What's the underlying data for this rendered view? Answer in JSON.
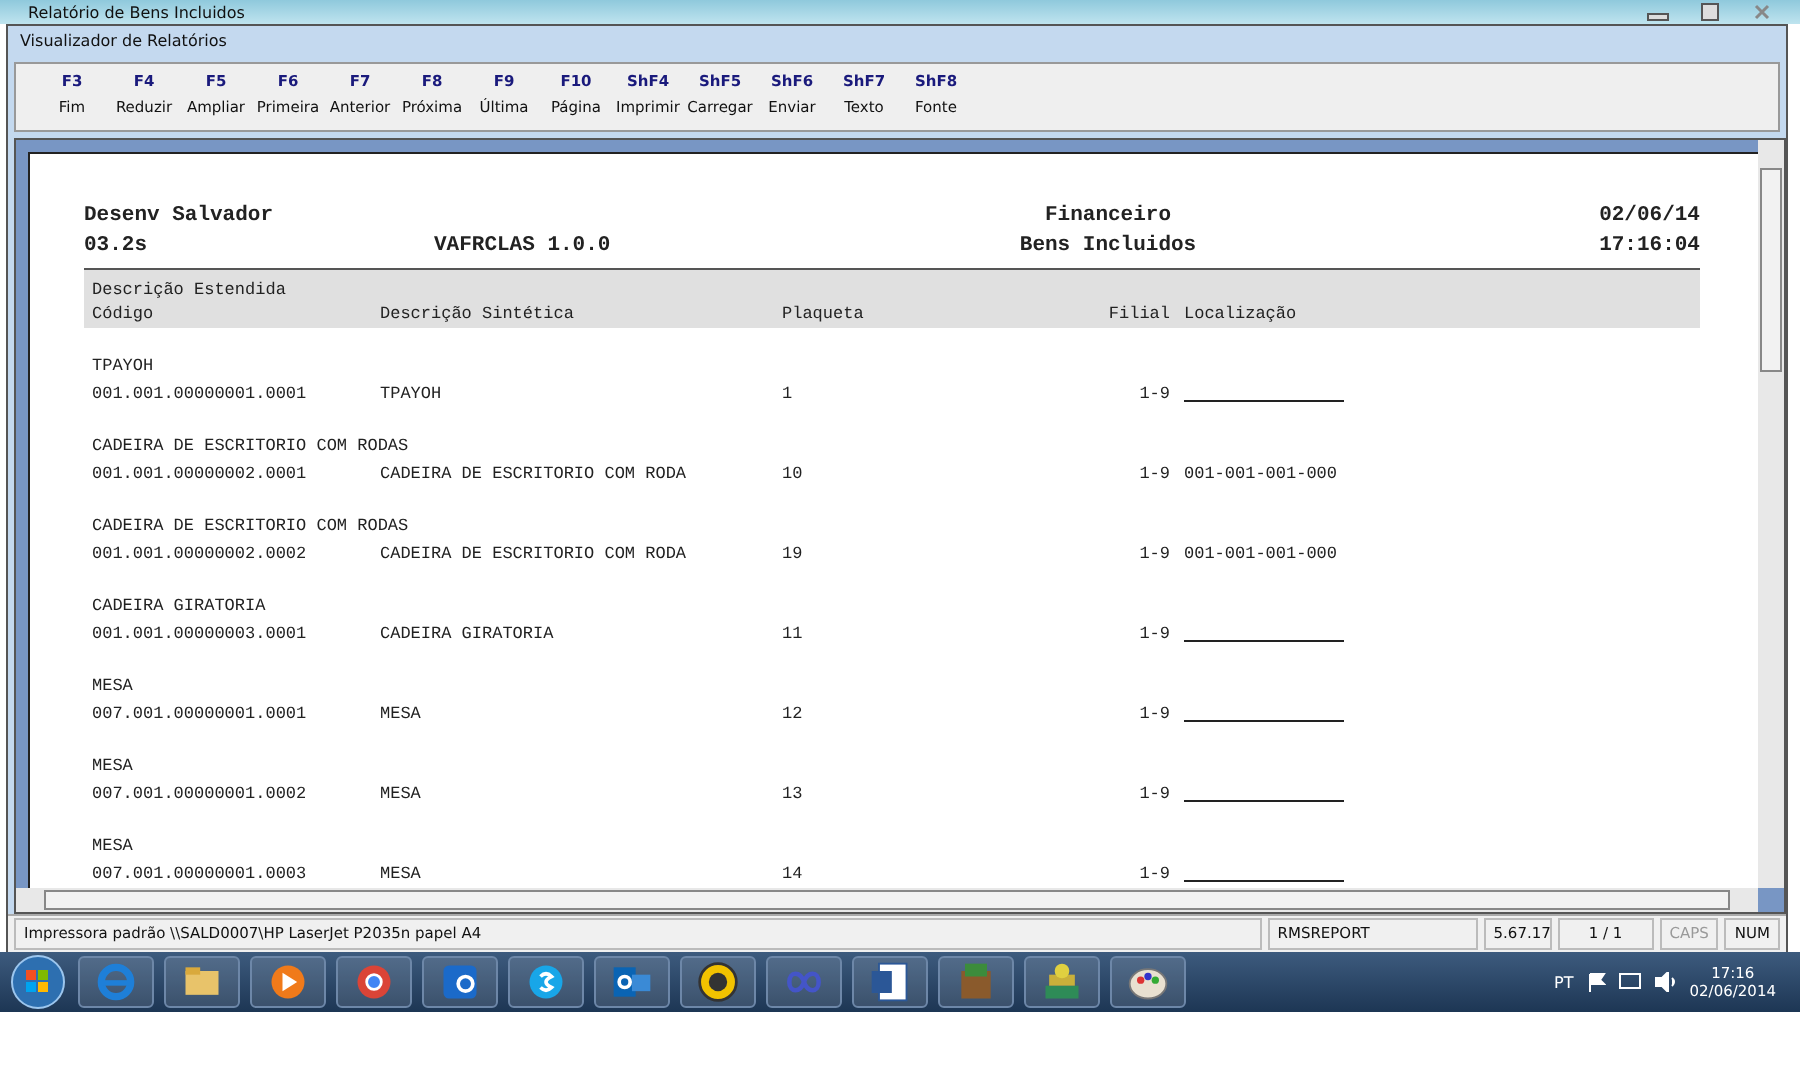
{
  "window": {
    "title": "Relatório de Bens Incluidos"
  },
  "viewer": {
    "title": "Visualizador de Relatórios"
  },
  "toolbar": [
    {
      "key": "F3",
      "label": "Fim"
    },
    {
      "key": "F4",
      "label": "Reduzir"
    },
    {
      "key": "F5",
      "label": "Ampliar"
    },
    {
      "key": "F6",
      "label": "Primeira"
    },
    {
      "key": "F7",
      "label": "Anterior"
    },
    {
      "key": "F8",
      "label": "Próxima"
    },
    {
      "key": "F9",
      "label": "Última"
    },
    {
      "key": "F10",
      "label": "Página"
    },
    {
      "key": "ShF4",
      "label": "Imprimir"
    },
    {
      "key": "ShF5",
      "label": "Carregar"
    },
    {
      "key": "ShF6",
      "label": "Enviar"
    },
    {
      "key": "ShF7",
      "label": "Texto"
    },
    {
      "key": "ShF8",
      "label": "Fonte"
    }
  ],
  "report": {
    "company": "Desenv Salvador",
    "module": "Financeiro",
    "date": "02/06/14",
    "version": "03.2s",
    "program": "VAFRCLAS 1.0.0",
    "title": "Bens Incluidos",
    "time": "17:16:04",
    "header_top": "Descrição Estendida",
    "columns": [
      "Código",
      "Descrição Sintética",
      "Plaqueta",
      "Filial",
      "Localização"
    ],
    "groups": [
      {
        "extended": "TPAYOH",
        "code": "001.001.00000001.0001",
        "description": "TPAYOH",
        "plaqueta": "1",
        "filial": "1-9"
      },
      {
        "extended": "CADEIRA DE ESCRITORIO COM RODAS",
        "code": "001.001.00000002.0001",
        "description": "CADEIRA DE ESCRITORIO COM RODA",
        "plaqueta": "10",
        "filial": "1-9",
        "location": "001-001-001-000"
      },
      {
        "extended": "CADEIRA DE ESCRITORIO COM RODAS",
        "code": "001.001.00000002.0002",
        "description": "CADEIRA DE ESCRITORIO COM RODA",
        "plaqueta": "19",
        "filial": "1-9",
        "location": "001-001-001-000"
      },
      {
        "extended": "CADEIRA GIRATORIA",
        "code": "001.001.00000003.0001",
        "description": "CADEIRA GIRATORIA",
        "plaqueta": "11",
        "filial": "1-9"
      },
      {
        "extended": "MESA",
        "code": "007.001.00000001.0001",
        "description": "MESA",
        "plaqueta": "12",
        "filial": "1-9"
      },
      {
        "extended": "MESA",
        "code": "007.001.00000001.0002",
        "description": "MESA",
        "plaqueta": "13",
        "filial": "1-9"
      },
      {
        "extended": "MESA",
        "code": "007.001.00000001.0003",
        "description": "MESA",
        "plaqueta": "14",
        "filial": "1-9"
      }
    ]
  },
  "status_bar": {
    "printer": "Impressora padrão \\\\SALD0007\\HP LaserJet P2035n papel A4",
    "report": "RMSREPORT",
    "version": "5.67.17",
    "pages": "1 / 1",
    "indicators": [
      {
        "label": "CAPS",
        "on": false
      },
      {
        "label": "NUM",
        "on": true
      }
    ]
  },
  "taskbar": {
    "language": "PT",
    "time": "17:16",
    "date": "02/06/2014"
  }
}
